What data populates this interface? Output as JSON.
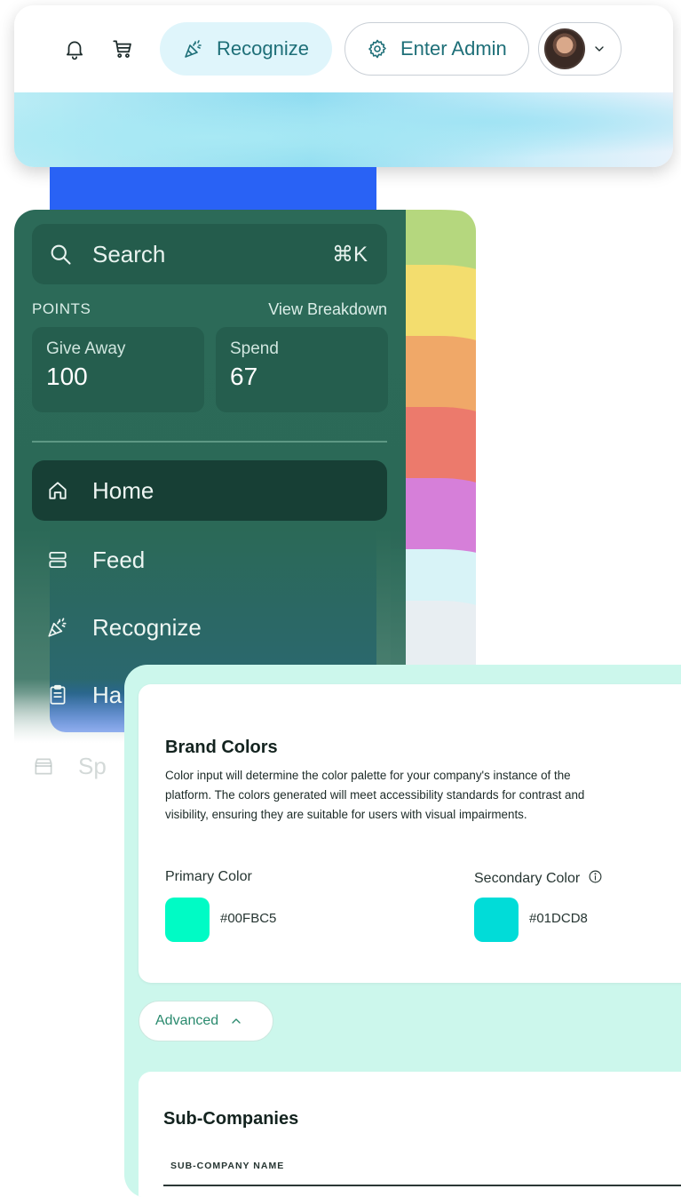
{
  "header": {
    "recognize_label": "Recognize",
    "admin_label": "Enter Admin",
    "icons": {
      "notifications": "bell-icon",
      "cart": "cart-icon",
      "recognize": "party-popper-icon",
      "admin": "gear-icon",
      "avatar_menu": "chevron-down-icon"
    }
  },
  "sidebar": {
    "search": {
      "label": "Search",
      "shortcut": "⌘K"
    },
    "points": {
      "label": "POINTS",
      "breakdown_link": "View Breakdown",
      "give_away": {
        "label": "Give Away",
        "value": "100"
      },
      "spend": {
        "label": "Spend",
        "value": "67"
      }
    },
    "nav": [
      {
        "label": "Home",
        "icon": "home-icon",
        "active": true
      },
      {
        "label": "Feed",
        "icon": "feed-icon",
        "active": false
      },
      {
        "label": "Recognize",
        "icon": "party-popper-icon",
        "active": false
      },
      {
        "label": "Ha",
        "icon": "clipboard-icon",
        "active": false
      },
      {
        "label": "Sp",
        "icon": "store-icon",
        "active": false
      }
    ]
  },
  "brand": {
    "title": "Brand Colors",
    "description": [
      "Color input will determine the color palette for your company's instance of the",
      "platform. The colors generated will meet accessibility standards for contrast and",
      "visibility, ensuring they are suitable for users with visual impairments."
    ],
    "primary": {
      "label": "Primary Color",
      "hex": "#00FBC5"
    },
    "secondary": {
      "label": "Secondary Color",
      "hex": "#01DCD8"
    },
    "advanced_label": "Advanced"
  },
  "sub_companies": {
    "title": "Sub-Companies",
    "column": "SUB-COMPANY NAME"
  },
  "colors": {
    "sidebar_green": "#2b6957",
    "accent_blue": "#2962f5",
    "panel_mint": "#ccf7ec",
    "rainbow": [
      "#b5d77e",
      "#f3dd6e",
      "#f0a868",
      "#ec7a6c",
      "#d67fd9",
      "#d8f3f7"
    ]
  }
}
